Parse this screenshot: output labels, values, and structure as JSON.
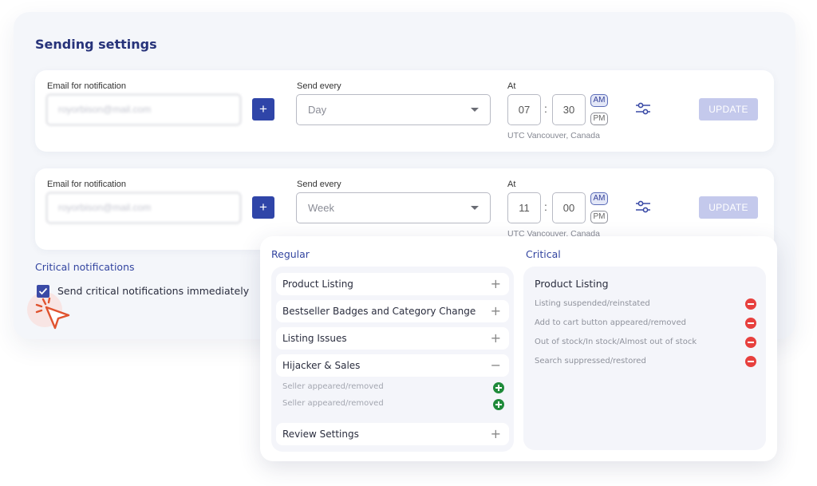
{
  "page": {
    "title": "Sending settings"
  },
  "settings": [
    {
      "email_label": "Email for notification",
      "email_value": "royorbison@mail.com",
      "add_label": "+",
      "send_label": "Send every",
      "send_value": "Day",
      "at_label": "At",
      "hour": "07",
      "minute": "30",
      "colon": ":",
      "am": "AM",
      "pm": "PM",
      "selected_period": "AM",
      "timezone": "UTC Vancouver, Canada",
      "update_label": "UPDATE"
    },
    {
      "email_label": "Email for notification",
      "email_value": "royorbison@mail.com",
      "add_label": "+",
      "send_label": "Send every",
      "send_value": "Week",
      "at_label": "At",
      "hour": "11",
      "minute": "00",
      "colon": ":",
      "am": "AM",
      "pm": "PM",
      "selected_period": "AM",
      "timezone": "UTC Vancouver, Canada",
      "update_label": "UPDATE"
    }
  ],
  "critical": {
    "title": "Critical notifications",
    "checkbox_label": "Send critical notifications immediately",
    "checked": true
  },
  "overlay": {
    "regular_title": "Regular",
    "critical_title": "Critical",
    "regular_items": [
      {
        "label": "Product Listing",
        "toggle": "+"
      },
      {
        "label": "Bestseller Badges and Category Change",
        "toggle": "+"
      },
      {
        "label": "Listing Issues",
        "toggle": "+"
      },
      {
        "label": "Hijacker & Sales",
        "toggle": "−"
      },
      {
        "label": "Review Settings",
        "toggle": "+"
      }
    ],
    "hijacker_subitems": [
      {
        "label": "Seller appeared/removed"
      },
      {
        "label": "Seller appeared/removed"
      }
    ],
    "critical_group": "Product Listing",
    "critical_items": [
      {
        "label": "Listing suspended/reinstated"
      },
      {
        "label": "Add to cart button appeared/removed"
      },
      {
        "label": "Out of stock/In stock/Almost out of stock"
      },
      {
        "label": "Search suppressed/restored"
      }
    ]
  },
  "colors": {
    "primary": "#2f45a8",
    "update_disabled": "#c4c9ec",
    "add_green": "#1f8a3a",
    "remove_red": "#e7403e",
    "cursor_accent": "#e0532f"
  }
}
